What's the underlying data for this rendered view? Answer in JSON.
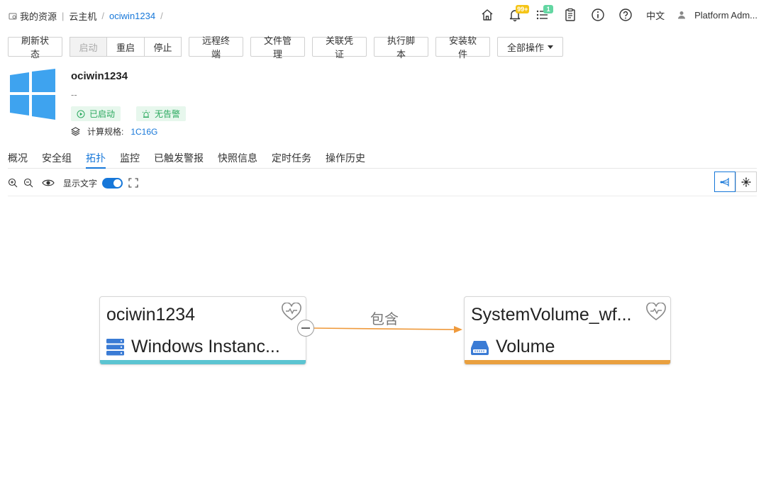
{
  "breadcrumb": {
    "root": "我的资源",
    "section": "云主机",
    "current": "ociwin1234",
    "trail_sep": "/"
  },
  "header": {
    "notification_badge": "99+",
    "task_badge": "1",
    "language": "中文",
    "user": "Platform Adm..."
  },
  "toolbar": {
    "refresh": "刷新状态",
    "start": "启动",
    "restart": "重启",
    "stop": "停止",
    "remote_terminal": "远程终端",
    "file_manager": "文件管理",
    "credential": "关联凭证",
    "run_script": "执行脚本",
    "install_software": "安装软件",
    "all_actions": "全部操作"
  },
  "instance": {
    "name": "ociwin1234",
    "description": "--",
    "status": "已启动",
    "alarm": "无告警",
    "spec_label": "计算规格:",
    "spec_value": "1C16G"
  },
  "tabs": [
    "概况",
    "安全组",
    "拓扑",
    "监控",
    "已触发警报",
    "快照信息",
    "定时任务",
    "操作历史"
  ],
  "active_tab": "拓扑",
  "topology": {
    "show_text_label": "显示文字",
    "show_text_enabled": true,
    "edge_label": "包含",
    "nodes": [
      {
        "title": "ociwin1234",
        "type": "Windows Instanc...",
        "bar_color": "#5bc4d1"
      },
      {
        "title": "SystemVolume_wf...",
        "type": "Volume",
        "bar_color": "#e9a03f"
      }
    ],
    "edge_color": "#ef9a3c"
  },
  "colors": {
    "accent": "#1677d9",
    "status_green": "#2aa95e",
    "windows_blue": "#3ea3ef"
  }
}
